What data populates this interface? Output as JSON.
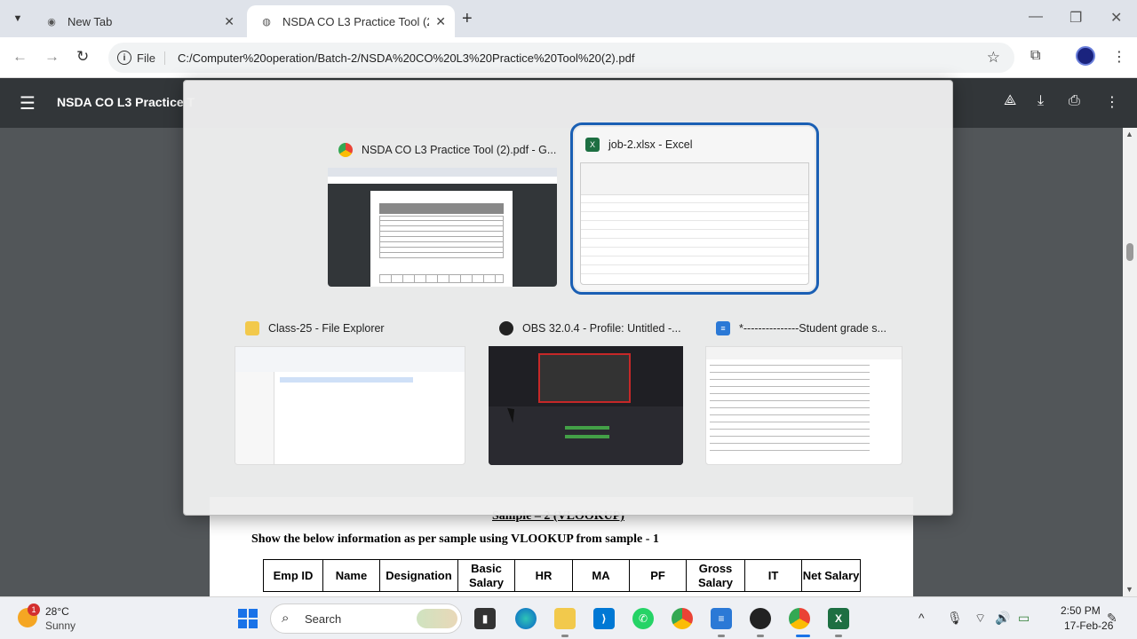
{
  "browser": {
    "tabs": [
      {
        "title": "New Tab",
        "active": false
      },
      {
        "title": "NSDA CO L3 Practice Tool (2).pdf",
        "active": true
      }
    ],
    "address": {
      "scheme": "File",
      "url": "C:/Computer%20operation/Batch-2/NSDA%20CO%20L3%20Practice%20Tool%20(2).pdf"
    }
  },
  "pdf": {
    "title": "NSDA CO L3 Practice T",
    "sample_title": "Sample – 2 (VLOOKUP)",
    "instruction": "Show the below information as per sample using VLOOKUP from sample - 1",
    "table_headers": [
      "Emp ID",
      "Name",
      "Designation",
      "Basic Salary",
      "HR",
      "MA",
      "PF",
      "Gross Salary",
      "IT",
      "Net Salary"
    ]
  },
  "switcher": {
    "windows": [
      {
        "title": "NSDA CO L3 Practice Tool (2).pdf - G...",
        "app": "chrome",
        "selected": false
      },
      {
        "title": "job-2.xlsx - Excel",
        "app": "excel",
        "selected": true
      },
      {
        "title": "Class-25 - File Explorer",
        "app": "explorer",
        "selected": false
      },
      {
        "title": "OBS 32.0.4 - Profile: Untitled -...",
        "app": "obs",
        "selected": false
      },
      {
        "title": "*---------------Student grade s...",
        "app": "notepad",
        "selected": false
      }
    ]
  },
  "taskbar": {
    "weather_temp": "28°C",
    "weather_desc": "Sunny",
    "weather_badge": "1",
    "search_label": "Search",
    "time": "2:50 PM",
    "date": "17-Feb-26"
  },
  "colors": {
    "selection": "#1a5fb4",
    "pdf_toolbar": "#323639",
    "excel_green": "#1d6f42",
    "chrome_blue": "#1a73e8"
  }
}
